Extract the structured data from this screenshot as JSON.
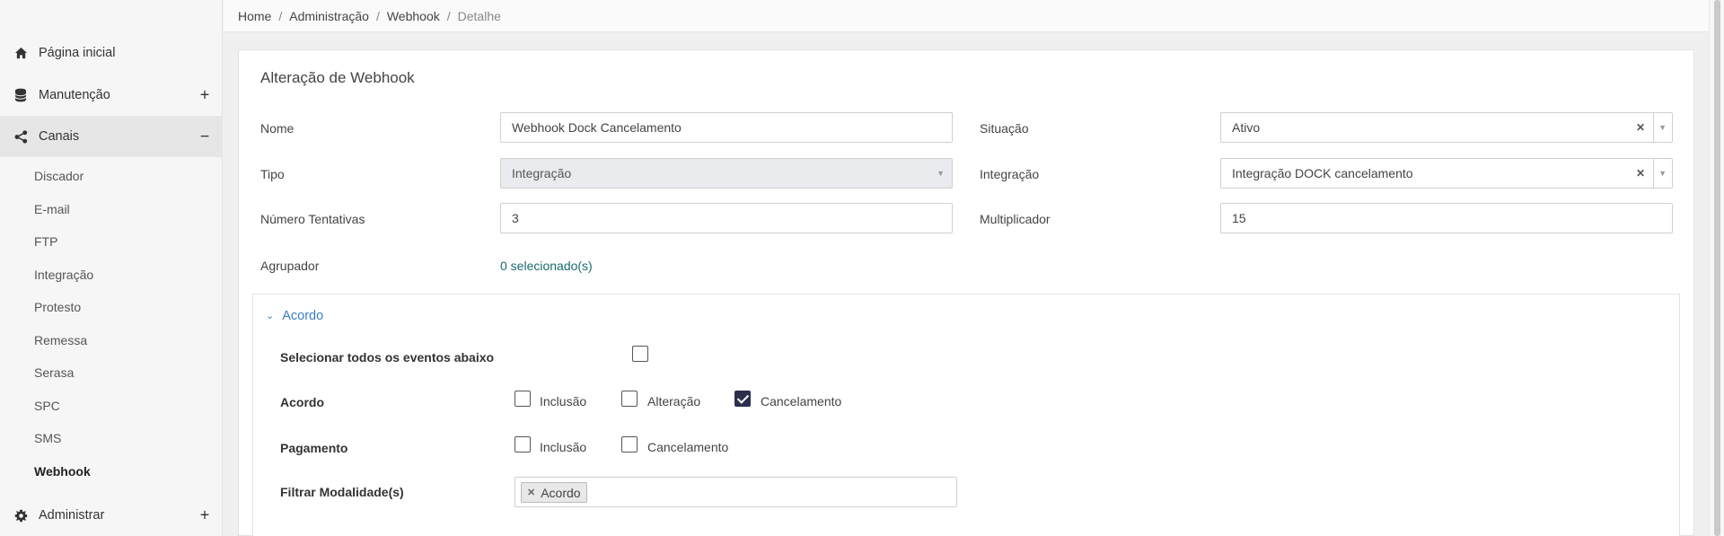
{
  "sidebar": {
    "items": [
      {
        "label": "Página inicial",
        "icon": "home-icon"
      },
      {
        "label": "Manutenção",
        "icon": "database-icon",
        "toggle": "+"
      },
      {
        "label": "Canais",
        "icon": "share-icon",
        "toggle": "−"
      },
      {
        "label": "Administrar",
        "icon": "gear-icon",
        "toggle": "+"
      }
    ],
    "subitems": [
      "Discador",
      "E-mail",
      "FTP",
      "Integração",
      "Protesto",
      "Remessa",
      "Serasa",
      "SPC",
      "SMS",
      "Webhook"
    ]
  },
  "breadcrumb": [
    "Home",
    "Administração",
    "Webhook",
    "Detalhe"
  ],
  "breadcrumb_sep": "/",
  "form": {
    "title": "Alteração de Webhook",
    "nome_label": "Nome",
    "nome_value": "Webhook Dock Cancelamento",
    "situacao_label": "Situação",
    "situacao_value": "Ativo",
    "tipo_label": "Tipo",
    "tipo_value": "Integração",
    "integracao_label": "Integração",
    "integracao_value": "Integração DOCK cancelamento",
    "tentativas_label": "Número Tentativas",
    "tentativas_value": "3",
    "multiplicador_label": "Multiplicador",
    "multiplicador_value": "15",
    "agrupador_label": "Agrupador",
    "agrupador_value": "0 selecionado(s)"
  },
  "section": {
    "title": "Acordo",
    "select_all_label": "Selecionar todos os eventos abaixo",
    "acordo_label": "Acordo",
    "acordo_options": [
      {
        "label": "Inclusão",
        "checked": false
      },
      {
        "label": "Alteração",
        "checked": false
      },
      {
        "label": "Cancelamento",
        "checked": true
      }
    ],
    "pagamento_label": "Pagamento",
    "pagamento_options": [
      {
        "label": "Inclusão",
        "checked": false
      },
      {
        "label": "Cancelamento",
        "checked": false
      }
    ],
    "filtro_label": "Filtrar Modalidade(s)",
    "filtro_tags": [
      "Acordo"
    ]
  },
  "colors": {
    "accent_link": "#3a7ec2",
    "checkbox_checked": "#2c2e4e",
    "agrupador_link": "#1a6a6e"
  }
}
